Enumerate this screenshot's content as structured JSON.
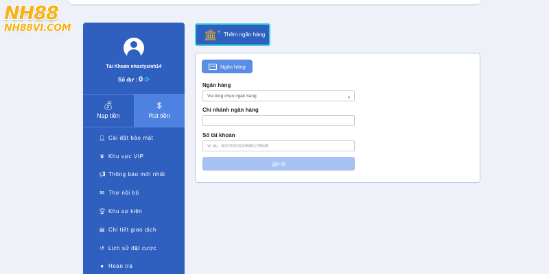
{
  "logo": {
    "main": "NH88",
    "sub": "NH88VI.COM"
  },
  "profile": {
    "account_text": "Tài Khoản nhoxtyxinh14",
    "balance_label": "Số dư :",
    "balance_value": "0",
    "refresh_icon": "refresh-icon"
  },
  "actions": {
    "deposit": {
      "label": "Nạp tiền",
      "icon": "money-bag-icon"
    },
    "withdraw": {
      "label": "Rút tiền",
      "icon": "hand-money-icon"
    }
  },
  "menu": {
    "items": [
      {
        "label": "Cài đặt bảo mật",
        "icon": "user-lock-icon"
      },
      {
        "label": "Khu vực VIP",
        "icon": "crown-icon"
      },
      {
        "label": "Thông báo mới nhất",
        "icon": "megaphone-icon"
      },
      {
        "label": "Thư nội bộ",
        "icon": "envelope-icon"
      },
      {
        "label": "Khu sự kiện",
        "icon": "trophy-icon"
      },
      {
        "label": "Chi tiết giao dịch",
        "icon": "clipboard-icon"
      },
      {
        "label": "Lịch sử đặt cược",
        "icon": "history-icon"
      },
      {
        "label": "Hoàn trả",
        "icon": "dollar-circle-icon"
      }
    ]
  },
  "add_bank_tab": {
    "label": "Thêm ngân hàng",
    "icon": "bank-plus-icon"
  },
  "form": {
    "chip_label": "Ngân hàng",
    "bank_label": "Ngân hàng",
    "bank_select_value": "Vui lòng chọn ngân hàng",
    "branch_label": "Chi nhánh ngân hàng",
    "branch_value": "",
    "account_number_label": "Số tài khoản",
    "account_number_placeholder": "Ví dụ : 6227002020690175526",
    "submit_label": "gửi đi"
  },
  "colors": {
    "sidebar": "#2f5fbf",
    "active_action": "#4d82e2",
    "accent_gold": "#f6b21a",
    "accent_cyan": "#3fd2e8",
    "submit_disabled": "#a6c2f2"
  }
}
